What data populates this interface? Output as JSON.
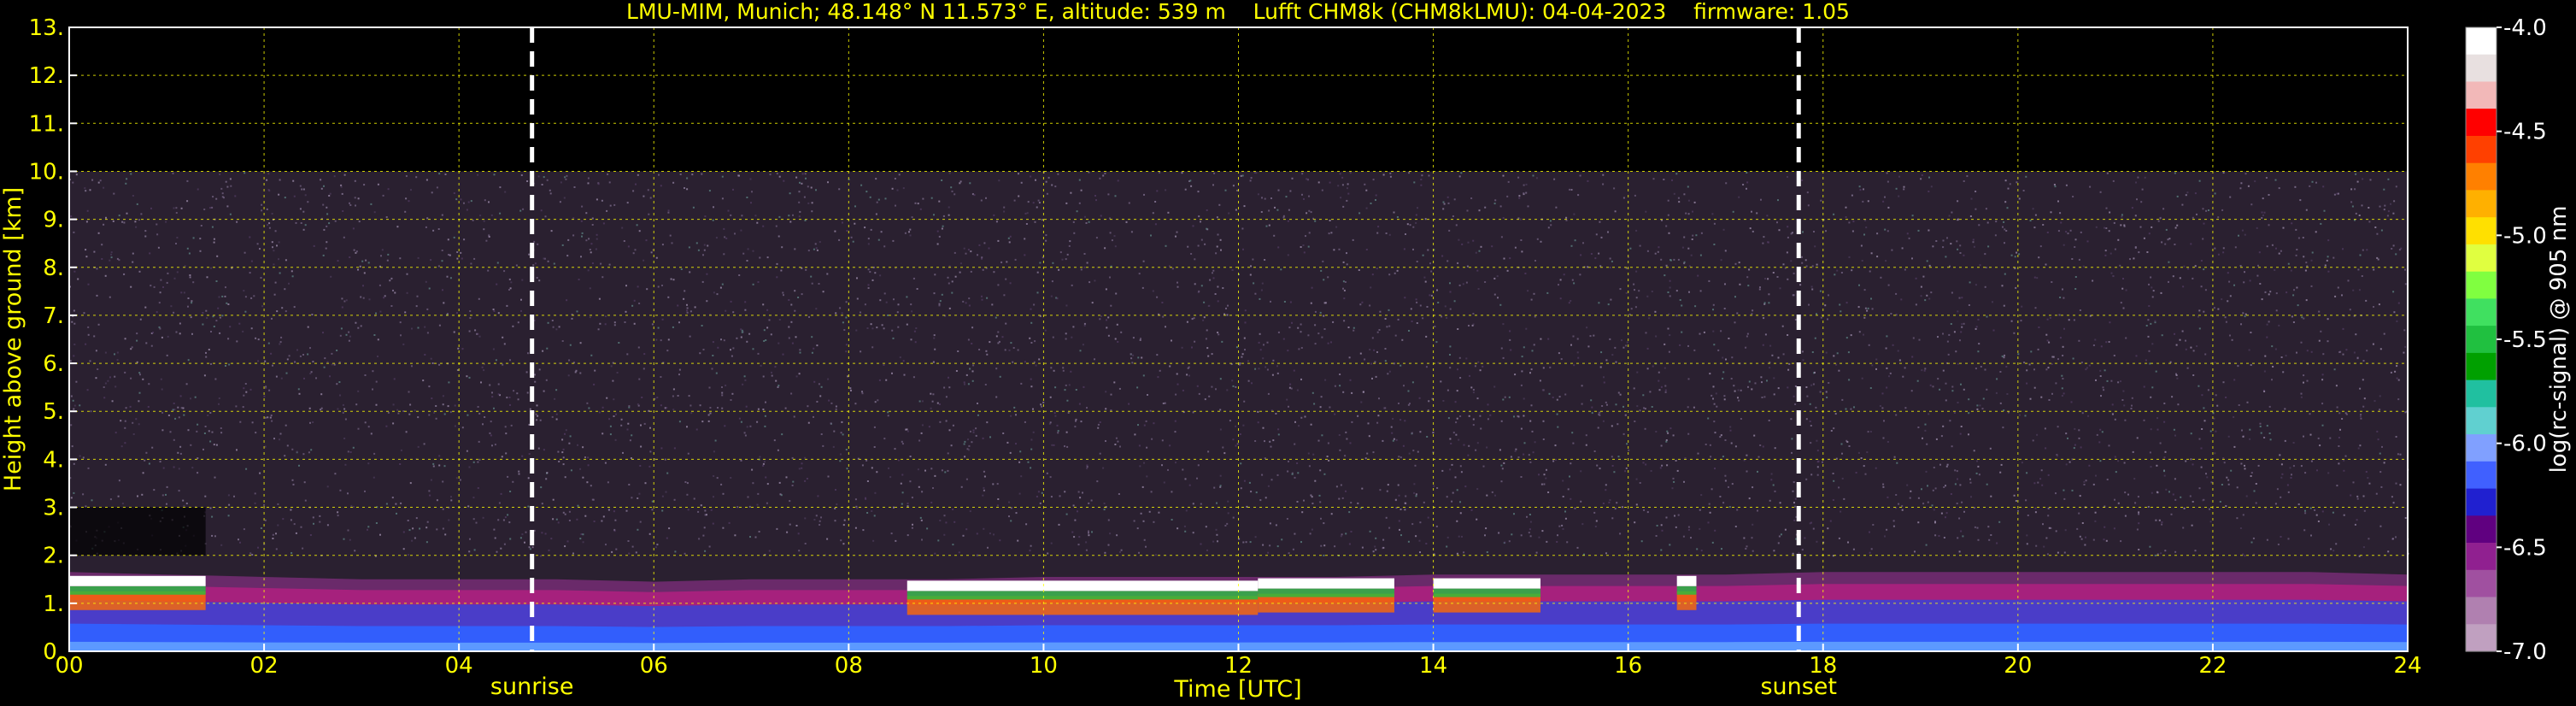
{
  "chart_data": {
    "type": "heatmap",
    "title": "LMU-MIM, Munich; 48.148° N 11.573° E, altitude: 539 m    Lufft CHM8k (CHM8kLMU): 04-04-2023    firmware: 1.05",
    "xlabel": "Time [UTC]",
    "ylabel": "Height above ground [km]",
    "xlim": [
      0,
      24
    ],
    "ylim": [
      0,
      13
    ],
    "x_ticks": [
      "00",
      "02",
      "04",
      "06",
      "08",
      "10",
      "12",
      "14",
      "16",
      "18",
      "20",
      "22",
      "24"
    ],
    "y_ticks": [
      "0.",
      "1.",
      "2.",
      "3.",
      "4.",
      "5.",
      "6.",
      "7.",
      "8.",
      "9.",
      "10.",
      "11.",
      "12.",
      "13."
    ],
    "grid": true,
    "signal_top_km": 10,
    "events": [
      {
        "label": "sunrise",
        "x": 4.75
      },
      {
        "label": "sunset",
        "x": 17.75
      }
    ],
    "colorbar": {
      "label": "log(rc-signal) @ 905 nm",
      "range": [
        -7.0,
        -4.0
      ],
      "ticks": [
        "-4.0",
        "-4.5",
        "-5.0",
        "-5.5",
        "-6.0",
        "-6.5",
        "-7.0"
      ],
      "colors": [
        "#ffffff",
        "#e8e0e0",
        "#f2b8b8",
        "#ff0000",
        "#ff4000",
        "#ff8000",
        "#ffb000",
        "#ffe000",
        "#e0ff40",
        "#80ff40",
        "#40e060",
        "#20c040",
        "#00a000",
        "#20c0a0",
        "#60d0d0",
        "#80a0ff",
        "#4060ff",
        "#2020d0",
        "#600080",
        "#902090",
        "#a050a0",
        "#b080b0",
        "#c0a0c0"
      ]
    },
    "layers": {
      "boundary_layer_top_km": [
        1.65,
        1.6,
        1.55,
        1.5,
        1.5,
        1.5,
        1.45,
        1.5,
        1.5,
        1.5,
        1.55,
        1.55,
        1.55,
        1.55,
        1.6,
        1.6,
        1.6,
        1.6,
        1.65,
        1.65,
        1.65,
        1.65,
        1.65,
        1.65,
        1.6
      ],
      "cloud_segments": [
        {
          "x0": 0.0,
          "x1": 1.4,
          "height_km": 1.5
        },
        {
          "x0": 8.6,
          "x1": 12.2,
          "height_km": 1.4
        },
        {
          "x0": 12.2,
          "x1": 13.6,
          "height_km": 1.45
        },
        {
          "x0": 14.0,
          "x1": 15.1,
          "height_km": 1.45
        },
        {
          "x0": 16.5,
          "x1": 16.7,
          "height_km": 1.5
        }
      ]
    }
  }
}
